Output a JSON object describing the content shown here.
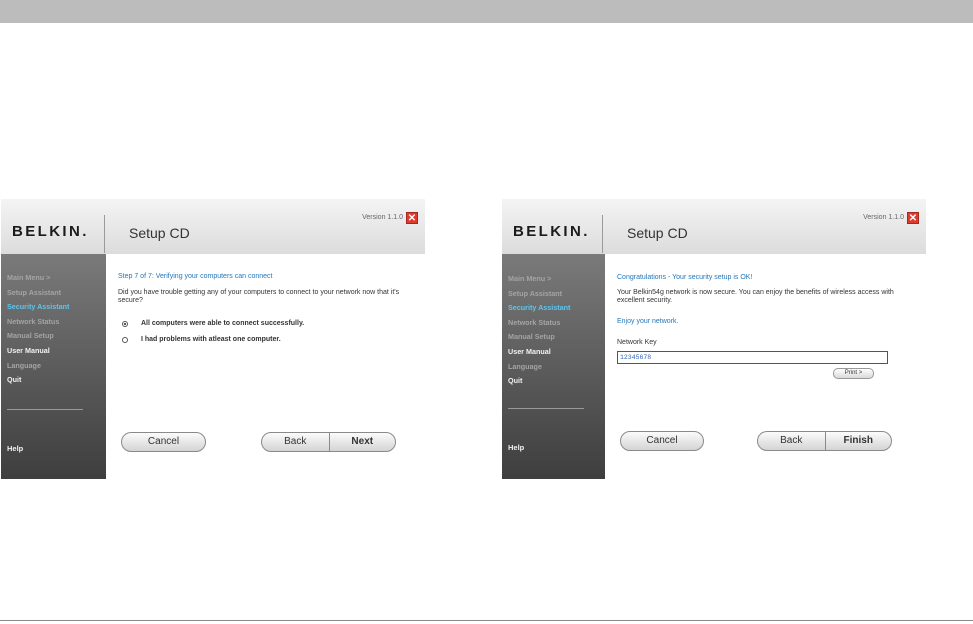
{
  "screens": {
    "left": {
      "logo": "BELKIN.",
      "title": "Setup CD",
      "version": "Version 1.1.0",
      "close_glyph": "✕",
      "menu": [
        "Main Menu >",
        "Setup Assistant",
        "Security Assistant",
        "Network Status",
        "Manual Setup",
        "User Manual",
        "Language",
        "Quit"
      ],
      "help": "Help",
      "step_title": "Step 7 of 7: Verifying your computers can connect",
      "question": "Did you have trouble getting any of your computers to connect to your network now that it's secure?",
      "options": [
        "All computers were able to connect successfully.",
        "I had problems with atleast one computer."
      ],
      "selected_option": 0,
      "cancel": "Cancel",
      "back": "Back",
      "next": "Next"
    },
    "right": {
      "logo": "BELKIN.",
      "title": "Setup CD",
      "version": "Version 1.1.0",
      "close_glyph": "✕",
      "menu": [
        "Main Menu >",
        "Setup Assistant",
        "Security Assistant",
        "Network Status",
        "Manual Setup",
        "User Manual",
        "Language",
        "Quit"
      ],
      "help": "Help",
      "congrats": "Congratulations - Your security setup is OK!",
      "message": "Your Belkin54g network is now secure. You can enjoy the benefits of wireless access with excellent security.",
      "enjoy": "Enjoy your network.",
      "key_label": "Network Key",
      "key_value": "12345678",
      "print": "Print >",
      "cancel": "Cancel",
      "back": "Back",
      "finish": "Finish"
    }
  },
  "colors": {
    "accent_blue": "#2277bb",
    "active_menu": "#5cc6ee",
    "close_red": "#e03a2c"
  },
  "icons": {
    "close": "close-icon",
    "radio": "radio-button"
  }
}
